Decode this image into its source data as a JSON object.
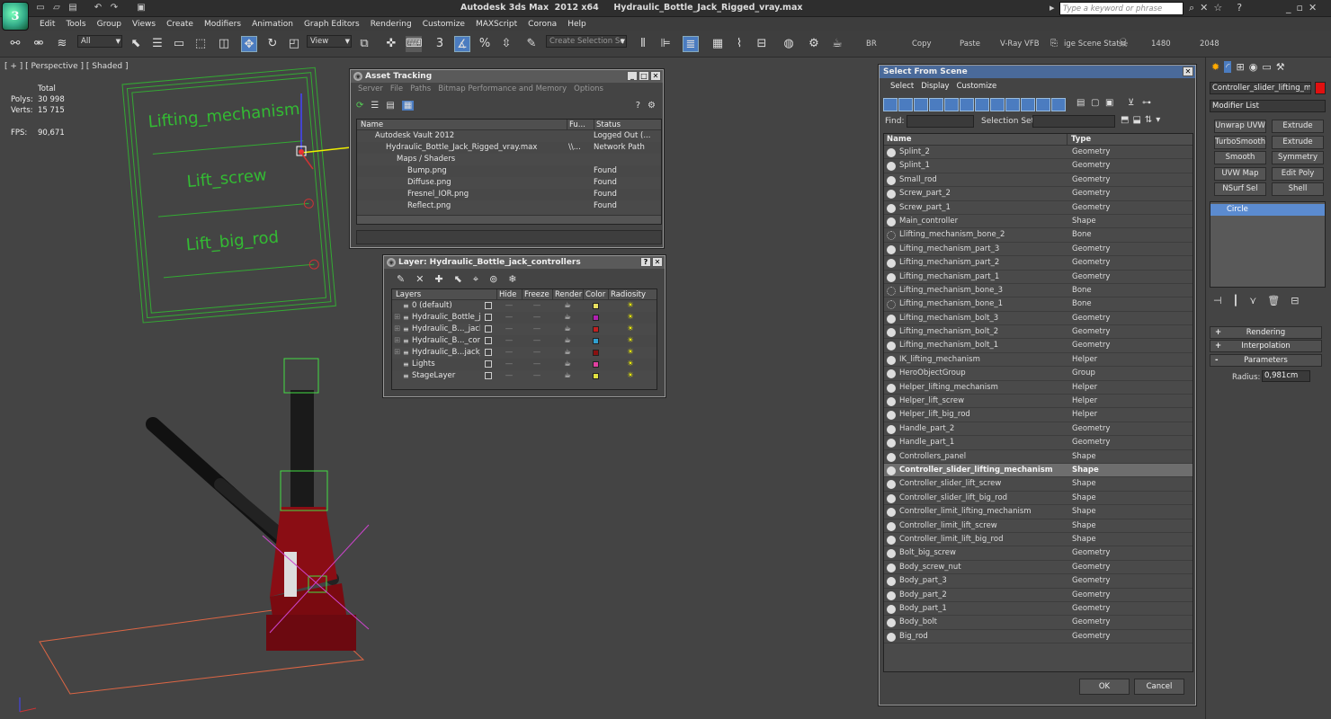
{
  "app": {
    "title": "Autodesk 3ds Max  2012 x64     Hydraulic_Bottle_Jack_Rigged_vray.max",
    "search_placeholder": "Type a keyword or phrase",
    "menu": [
      "Edit",
      "Tools",
      "Group",
      "Views",
      "Create",
      "Modifiers",
      "Animation",
      "Graph Editors",
      "Rendering",
      "Customize",
      "MAXScript",
      "Corona",
      "Help"
    ]
  },
  "toolbar": {
    "filter_value": "All",
    "view_value": "View",
    "selection_set_placeholder": "Create Selection Se",
    "labels": {
      "br": "BR",
      "copy": "Copy",
      "paste": "Paste",
      "vray_vfb": "V-Ray VFB",
      "scene_states": "ige Scene Stat",
      "w": "1480",
      "h": "2048"
    }
  },
  "viewport": {
    "label": "[ + ] [ Perspective ] [ Shaded ]",
    "stats": {
      "total_label": "Total",
      "polys_label": "Polys:",
      "polys_value": "30 998",
      "verts_label": "Verts:",
      "verts_value": "15 715",
      "fps_label": "FPS:",
      "fps_value": "90,671"
    },
    "panel_labels": [
      "Lifting_mechanism",
      "Lift_screw",
      "Lift_big_rod"
    ]
  },
  "asset_tracking": {
    "title": "Asset Tracking",
    "menu": [
      "Server",
      "File",
      "Paths",
      "Bitmap Performance and Memory",
      "Options"
    ],
    "columns": [
      "Name",
      "Fu...",
      "Status"
    ],
    "rows": [
      {
        "name": "Autodesk Vault 2012",
        "full": "",
        "status": "Logged Out (..."
      },
      {
        "name": "Hydraulic_Bottle_Jack_Rigged_vray.max",
        "full": "\\\\...",
        "status": "Network Path"
      },
      {
        "name": "Maps / Shaders",
        "full": "",
        "status": ""
      },
      {
        "name": "Bump.png",
        "full": "",
        "status": "Found"
      },
      {
        "name": "Diffuse.png",
        "full": "",
        "status": "Found"
      },
      {
        "name": "Fresnel_IOR.png",
        "full": "",
        "status": "Found"
      },
      {
        "name": "Reflect.png",
        "full": "",
        "status": "Found"
      }
    ]
  },
  "layer_manager": {
    "title": "Layer: Hydraulic_Bottle_jack_controllers",
    "columns": [
      "Layers",
      "Hide",
      "Freeze",
      "Render",
      "Color",
      "Radiosity"
    ],
    "rows": [
      {
        "name": "0 (default)",
        "color": "#e8e060"
      },
      {
        "name": "Hydraulic_Bottle_jac",
        "color": "#b020b0"
      },
      {
        "name": "Hydraulic_B..._jack_",
        "color": "#c02020"
      },
      {
        "name": "Hydraulic_B..._cont",
        "color": "#30a0d0"
      },
      {
        "name": "Hydraulic_B...jack_l",
        "color": "#8a1010"
      },
      {
        "name": "Lights",
        "color": "#e040a0"
      },
      {
        "name": "StageLayer",
        "color": "#e0e040"
      }
    ]
  },
  "select_from_scene": {
    "title": "Select From Scene",
    "menu": [
      "Select",
      "Display",
      "Customize"
    ],
    "find_label": "Find:",
    "selection_set_label": "Selection Set:",
    "columns": [
      "Name",
      "Type"
    ],
    "rows": [
      {
        "name": "Splint_2",
        "type": "Geometry"
      },
      {
        "name": "Splint_1",
        "type": "Geometry"
      },
      {
        "name": "Small_rod",
        "type": "Geometry"
      },
      {
        "name": "Screw_part_2",
        "type": "Geometry"
      },
      {
        "name": "Screw_part_1",
        "type": "Geometry"
      },
      {
        "name": "Main_controller",
        "type": "Shape"
      },
      {
        "name": "Llifting_mechanism_bone_2",
        "type": "Bone"
      },
      {
        "name": "Lifting_mechanism_part_3",
        "type": "Geometry"
      },
      {
        "name": "Lifting_mechanism_part_2",
        "type": "Geometry"
      },
      {
        "name": "Lifting_mechanism_part_1",
        "type": "Geometry"
      },
      {
        "name": "Lifting_mechanism_bone_3",
        "type": "Bone"
      },
      {
        "name": "Lifting_mechanism_bone_1",
        "type": "Bone"
      },
      {
        "name": "Lifting_mechanism_bolt_3",
        "type": "Geometry"
      },
      {
        "name": "Lifting_mechanism_bolt_2",
        "type": "Geometry"
      },
      {
        "name": "Lifting_mechanism_bolt_1",
        "type": "Geometry"
      },
      {
        "name": "IK_lifting_mechanism",
        "type": "Helper"
      },
      {
        "name": "HeroObjectGroup",
        "type": "Group"
      },
      {
        "name": "Helper_lifting_mechanism",
        "type": "Helper"
      },
      {
        "name": "Helper_lift_screw",
        "type": "Helper"
      },
      {
        "name": "Helper_lift_big_rod",
        "type": "Helper"
      },
      {
        "name": "Handle_part_2",
        "type": "Geometry"
      },
      {
        "name": "Handle_part_1",
        "type": "Geometry"
      },
      {
        "name": "Controllers_panel",
        "type": "Shape"
      },
      {
        "name": "Controller_slider_lifting_mechanism",
        "type": "Shape"
      },
      {
        "name": "Controller_slider_lift_screw",
        "type": "Shape"
      },
      {
        "name": "Controller_slider_lift_big_rod",
        "type": "Shape"
      },
      {
        "name": "Controller_limit_lifting_mechanism",
        "type": "Shape"
      },
      {
        "name": "Controller_limit_lift_screw",
        "type": "Shape"
      },
      {
        "name": "Controller_limit_lift_big_rod",
        "type": "Shape"
      },
      {
        "name": "Bolt_big_screw",
        "type": "Geometry"
      },
      {
        "name": "Body_screw_nut",
        "type": "Geometry"
      },
      {
        "name": "Body_part_3",
        "type": "Geometry"
      },
      {
        "name": "Body_part_2",
        "type": "Geometry"
      },
      {
        "name": "Body_part_1",
        "type": "Geometry"
      },
      {
        "name": "Body_bolt",
        "type": "Geometry"
      },
      {
        "name": "Big_rod",
        "type": "Geometry"
      }
    ],
    "selected_index": 23,
    "ok_label": "OK",
    "cancel_label": "Cancel"
  },
  "command_panel": {
    "object_name": "Controller_slider_lifting_mech",
    "object_color": "#e01010",
    "modifier_list_label": "Modifier List",
    "buttons": [
      "Unwrap UVW",
      "Extrude",
      "TurboSmooth",
      "Extrude",
      "Smooth",
      "Symmetry",
      "UVW Map",
      "Edit Poly",
      "NSurf Sel",
      "Shell"
    ],
    "stack_item": "Circle",
    "rollouts": [
      "Rendering",
      "Interpolation",
      "Parameters"
    ],
    "radius_label": "Radius:",
    "radius_value": "0,981cm"
  }
}
